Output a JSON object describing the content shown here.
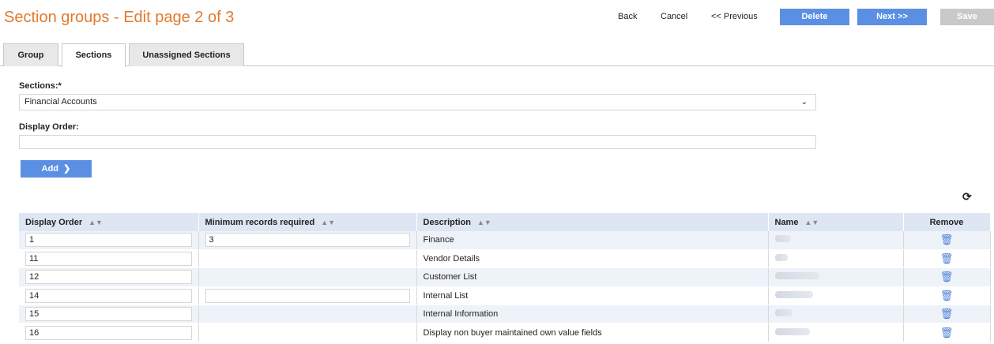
{
  "header": {
    "title": "Section groups - Edit page 2 of 3",
    "back": "Back",
    "cancel": "Cancel",
    "previous": "<< Previous",
    "delete": "Delete",
    "next": "Next >>",
    "save": "Save"
  },
  "tabs": [
    "Group",
    "Sections",
    "Unassigned Sections"
  ],
  "form": {
    "sections_label": "Sections:*",
    "sections_value": "Financial Accounts",
    "display_order_label": "Display Order:",
    "display_order_value": "",
    "add_label": "Add",
    "add_icon": "chevron-right-icon"
  },
  "table": {
    "columns": [
      "Display Order",
      "Minimum records required",
      "Description",
      "Name",
      "Remove"
    ],
    "rows": [
      {
        "display_order": "1",
        "min_records": "3",
        "has_min_input": true,
        "description": "Finance"
      },
      {
        "display_order": "11",
        "min_records": "",
        "has_min_input": false,
        "description": "Vendor Details"
      },
      {
        "display_order": "12",
        "min_records": "",
        "has_min_input": false,
        "description": "Customer List"
      },
      {
        "display_order": "14",
        "min_records": "",
        "has_min_input": true,
        "description": "Internal List"
      },
      {
        "display_order": "15",
        "min_records": "",
        "has_min_input": false,
        "description": "Internal Information"
      },
      {
        "display_order": "16",
        "min_records": "",
        "has_min_input": false,
        "description": "Display non buyer maintained own value fields"
      }
    ]
  },
  "colors": {
    "title": "#e07b2e",
    "primary_button": "#5b8fe3",
    "disabled_button": "#c9c9c9",
    "header_row": "#dde6f2",
    "trash_icon": "#4a7dd6"
  }
}
